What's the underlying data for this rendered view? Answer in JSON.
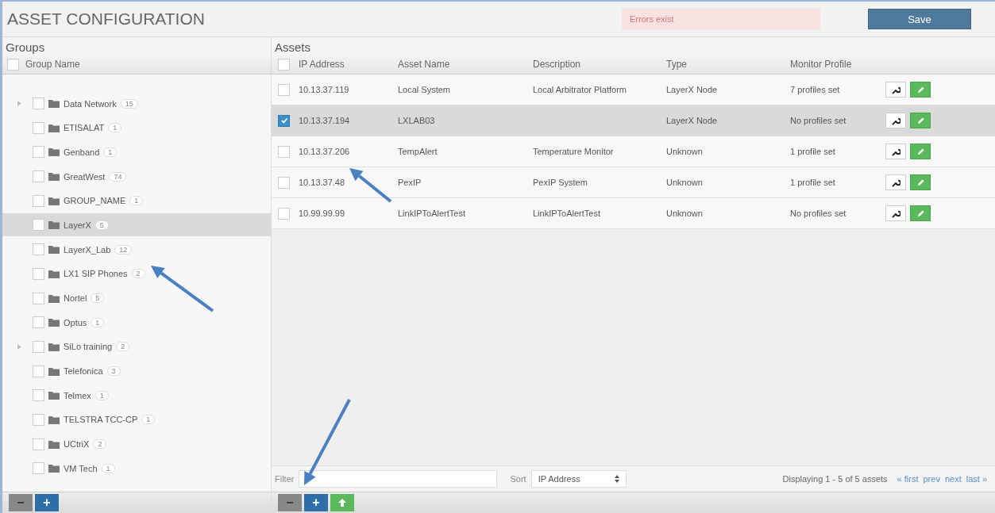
{
  "title": "ASSET CONFIGURATION",
  "error_message": "Errors exist",
  "save_button": "Save",
  "groups": {
    "heading": "Groups",
    "column": "Group Name",
    "header_checked": false,
    "items": [
      {
        "name": "Data Network",
        "count": "15",
        "expandable": true,
        "checked": false,
        "selected": false
      },
      {
        "name": "ETISALAT",
        "count": "1",
        "expandable": false,
        "checked": false,
        "selected": false
      },
      {
        "name": "Genband",
        "count": "1",
        "expandable": false,
        "checked": false,
        "selected": false
      },
      {
        "name": "GreatWest",
        "count": "74",
        "expandable": false,
        "checked": false,
        "selected": false
      },
      {
        "name": "GROUP_NAME",
        "count": "1",
        "expandable": false,
        "checked": false,
        "selected": false
      },
      {
        "name": "LayerX",
        "count": "5",
        "expandable": false,
        "checked": false,
        "selected": true
      },
      {
        "name": "LayerX_Lab",
        "count": "12",
        "expandable": false,
        "checked": false,
        "selected": false
      },
      {
        "name": "LX1 SIP Phones",
        "count": "2",
        "expandable": false,
        "checked": false,
        "selected": false
      },
      {
        "name": "Nortel",
        "count": "5",
        "expandable": false,
        "checked": false,
        "selected": false
      },
      {
        "name": "Optus",
        "count": "1",
        "expandable": false,
        "checked": false,
        "selected": false
      },
      {
        "name": "SiLo training",
        "count": "2",
        "expandable": true,
        "checked": false,
        "selected": false
      },
      {
        "name": "Telefonica",
        "count": "3",
        "expandable": false,
        "checked": false,
        "selected": false
      },
      {
        "name": "Telmex",
        "count": "1",
        "expandable": false,
        "checked": false,
        "selected": false
      },
      {
        "name": "TELSTRA TCC-CP",
        "count": "1",
        "expandable": false,
        "checked": false,
        "selected": false
      },
      {
        "name": "UCtriX",
        "count": "2",
        "expandable": false,
        "checked": false,
        "selected": false
      },
      {
        "name": "VM Tech",
        "count": "1",
        "expandable": false,
        "checked": false,
        "selected": false
      }
    ],
    "buttons": [
      {
        "kind": "remove",
        "label": "−"
      },
      {
        "kind": "add",
        "label": "+"
      }
    ]
  },
  "assets": {
    "heading": "Assets",
    "header_checked": false,
    "columns": [
      "IP Address",
      "Asset Name",
      "Description",
      "Type",
      "Monitor Profile"
    ],
    "rows": [
      {
        "cells": [
          "10.13.37.119",
          "Local System",
          "Local Arbitrator Platform",
          "LayerX Node",
          "7 profiles set"
        ],
        "checked": false,
        "selected": false
      },
      {
        "cells": [
          "10.13.37.194",
          "LXLAB03",
          "",
          "LayerX Node",
          "No profiles set"
        ],
        "checked": true,
        "selected": true
      },
      {
        "cells": [
          "10.13.37.206",
          "TempAlert",
          "Temperature Monitor",
          "Unknown",
          "1 profile set"
        ],
        "checked": false,
        "selected": false
      },
      {
        "cells": [
          "10.13.37.48",
          "PexIP",
          "PexIP System",
          "Unknown",
          "1 profile set"
        ],
        "checked": false,
        "selected": false
      },
      {
        "cells": [
          "10.99.99.99",
          "LinkIPToAlertTest",
          "LinkIPToAlertTest",
          "Unknown",
          "No profiles set"
        ],
        "checked": false,
        "selected": false
      }
    ],
    "filter_label": "Filter",
    "sort_label": "Sort",
    "sort_value": "IP Address",
    "paging_info": "Displaying 1 - 5 of 5 assets",
    "paging_links": [
      "« first",
      "prev",
      "next",
      "last »"
    ],
    "buttons": [
      {
        "kind": "remove",
        "label": "−"
      },
      {
        "kind": "add",
        "label": "+"
      },
      {
        "kind": "upload"
      }
    ]
  }
}
